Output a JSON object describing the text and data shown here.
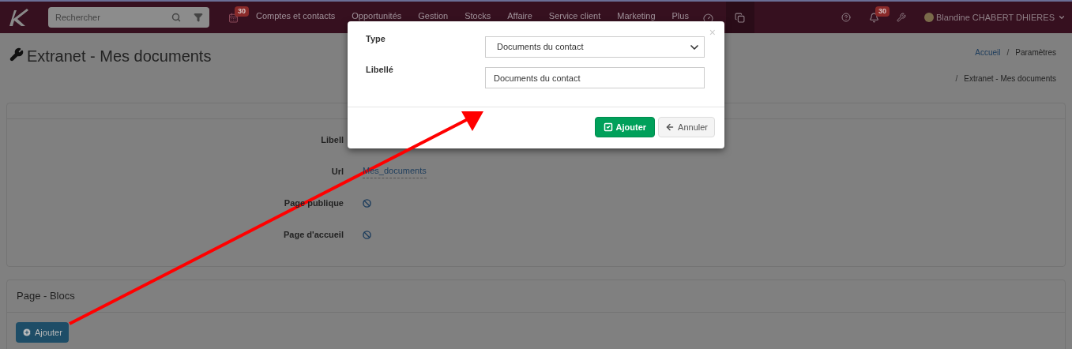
{
  "navbar": {
    "search": {
      "placeholder": "Rechercher"
    },
    "calendar_badge": "30",
    "menu": [
      "Comptes et contacts",
      "Opportunités",
      "Gestion",
      "Stocks",
      "Affaire",
      "Service client",
      "Marketing",
      "Plus"
    ],
    "notification_badge": "30",
    "user": "Blandine CHABERT DHIERES"
  },
  "page": {
    "title": "Extranet - Mes documents",
    "breadcrumb": [
      "Accueil",
      "Paramètres",
      "Extranet - Mes documents"
    ],
    "breadcrumb_separator": "/"
  },
  "details": [
    {
      "kind": "text",
      "label": "Libell"
    },
    {
      "kind": "text",
      "label": "Url",
      "value": "Mes_documents"
    },
    {
      "kind": "flag",
      "label": "Page publique",
      "checked": false
    },
    {
      "kind": "flag",
      "label": "Page d'accueil",
      "checked": false
    }
  ],
  "blocks": {
    "title": "Page - Blocs",
    "button": "Ajouter"
  },
  "modal": {
    "close": "×",
    "fields": [
      {
        "kind": "select",
        "label": "Type",
        "value": "Documents du contact"
      },
      {
        "kind": "text",
        "label": "Libellé",
        "value": "Documents du contact"
      }
    ],
    "buttons": [
      {
        "kind": "primary",
        "label": "Ajouter"
      },
      {
        "kind": "secondary",
        "label": "Annuler"
      }
    ]
  }
}
